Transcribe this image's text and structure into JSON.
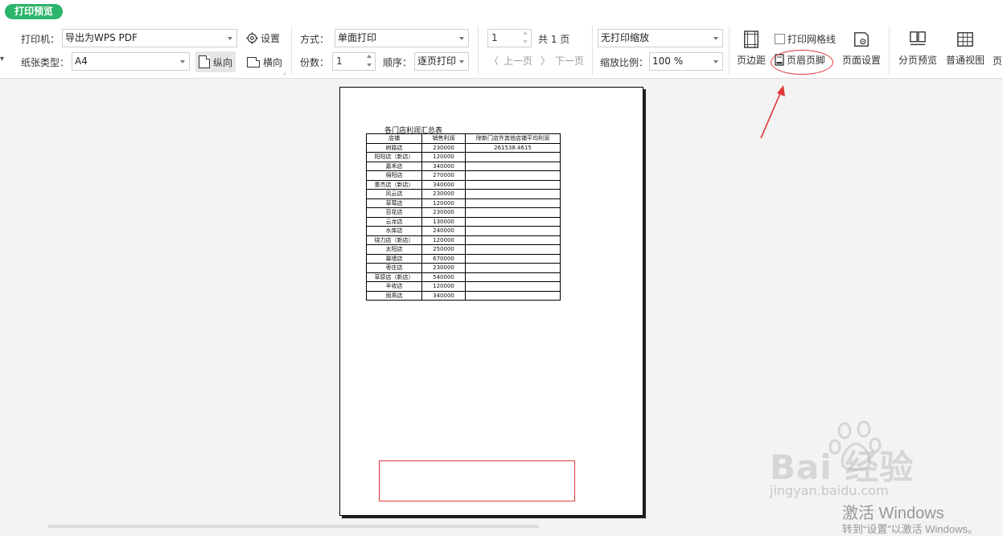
{
  "ribbon": {
    "mode_label": "打印预览",
    "printer_label": "打印机：",
    "printer_value": "导出为WPS PDF",
    "settings_label": "设置",
    "paper_label": "纸张类型：",
    "paper_value": "A4",
    "portrait_label": "纵向",
    "landscape_label": "横向",
    "method_label": "方式：",
    "method_value": "单面打印",
    "copies_label": "份数：",
    "copies_value": "1",
    "order_label": "顺序：",
    "order_value": "逐页打印",
    "page_current": "1",
    "page_total": "共 1 页",
    "prev_page": "上一页",
    "next_page": "下一页",
    "scaling_value": "无打印缩放",
    "zoom_label": "缩放比例：",
    "zoom_value": "100 %",
    "gridlines_label": "打印网格线",
    "margins_label": "页边距",
    "header_footer_label": "页眉页脚",
    "page_setup_label": "页面设置",
    "page_break_preview_label": "分页预览",
    "normal_view_label": "普通视图",
    "cut_label": "页"
  },
  "sheet": {
    "title": "各门店利润汇总表",
    "headers": [
      "店铺",
      "销售利润",
      "除新门店外其他店铺平均利润"
    ],
    "rows": [
      [
        "树路店",
        "230000",
        "261538.4615"
      ],
      [
        "阳阳店（新店）",
        "120000",
        ""
      ],
      [
        "嘉禾店",
        "340000",
        ""
      ],
      [
        "绵阳店",
        "270000",
        ""
      ],
      [
        "重杰店（新店）",
        "340000",
        ""
      ],
      [
        "风云店",
        "230000",
        ""
      ],
      [
        "草莓店",
        "120000",
        ""
      ],
      [
        "百花店",
        "230000",
        ""
      ],
      [
        "云龙店",
        "130000",
        ""
      ],
      [
        "水库店",
        "240000",
        ""
      ],
      [
        "绕力店（新店）",
        "120000",
        ""
      ],
      [
        "太阳店",
        "250000",
        ""
      ],
      [
        "幕墙店",
        "670000",
        ""
      ],
      [
        "枣庄店",
        "230000",
        ""
      ],
      [
        "草原店（新店）",
        "540000",
        ""
      ],
      [
        "丰收店",
        "120000",
        ""
      ],
      [
        "雨燕店",
        "340000",
        ""
      ]
    ]
  },
  "watermark": {
    "brand": "Bai  经验",
    "url": "jingyan.baidu.com"
  },
  "os_notice": {
    "title": "激活 Windows",
    "subtitle": "转到“设置”以激活 Windows。"
  },
  "colors": {
    "accent": "#2bb46a",
    "annotation": "#e0373b"
  }
}
